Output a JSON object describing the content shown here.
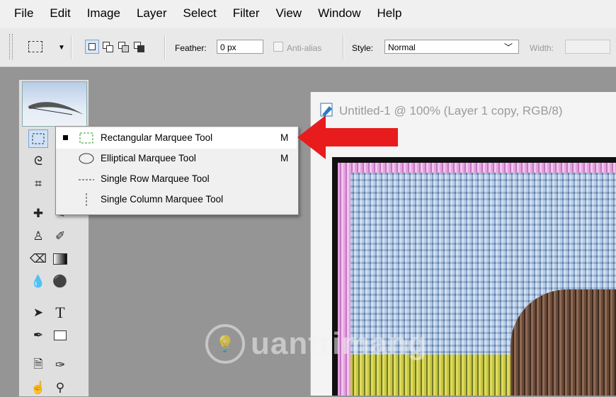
{
  "menu": [
    "File",
    "Edit",
    "Image",
    "Layer",
    "Select",
    "Filter",
    "View",
    "Window",
    "Help"
  ],
  "options": {
    "feather_label": "Feather:",
    "feather_value": "0 px",
    "antialias_label": "Anti-alias",
    "style_label": "Style:",
    "style_value": "Normal",
    "width_label": "Width:"
  },
  "document": {
    "title": "Untitled-1 @ 100% (Layer 1 copy, RGB/8)"
  },
  "flyout": [
    {
      "label": "Rectangular Marquee Tool",
      "shortcut": "M",
      "icon": "rect-marquee-icon",
      "active": true
    },
    {
      "label": "Elliptical Marquee Tool",
      "shortcut": "M",
      "icon": "ellipse-marquee-icon",
      "active": false
    },
    {
      "label": "Single Row Marquee Tool",
      "shortcut": "",
      "icon": "row-marquee-icon",
      "active": false
    },
    {
      "label": "Single Column Marquee Tool",
      "shortcut": "",
      "icon": "column-marquee-icon",
      "active": false
    }
  ],
  "watermark": "uantrimang",
  "colors": {
    "arrow": "#e81c1c",
    "highlight": "#cfe2f7"
  }
}
